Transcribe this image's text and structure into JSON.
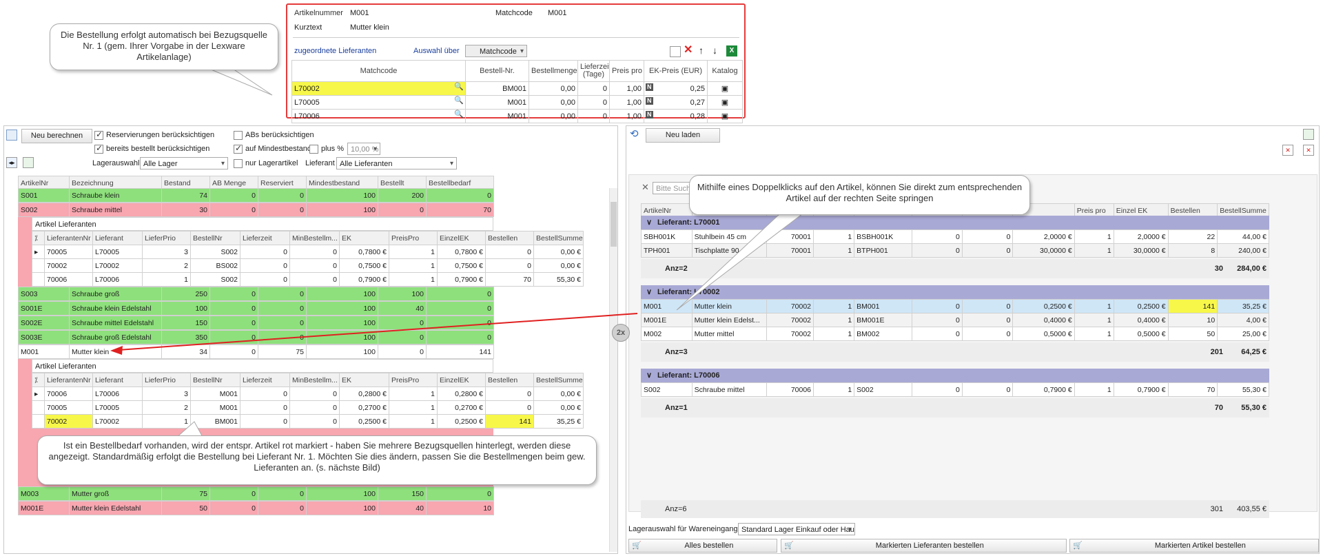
{
  "top": {
    "artikelnummer_label": "Artikelnummer",
    "artikelnummer": "M001",
    "matchcode_label": "Matchcode",
    "matchcode": "M001",
    "kurztext_label": "Kurztext",
    "kurztext": "Mutter klein",
    "tab_label": "zugeordnete Lieferanten",
    "auswahl_label": "Auswahl über",
    "auswahl_value": "Matchcode",
    "columns": [
      "Matchcode",
      "Bestell-Nr.",
      "Bestellmenge",
      "Lieferzeit (Tage)",
      "Preis pro",
      "EK-Preis (EUR)",
      "Katalog"
    ],
    "rows": [
      {
        "matchcode": "L70002",
        "bestellnr": "BM001",
        "menge": "0,00",
        "lieferzeit": "0",
        "preis_pro": "1,00",
        "n": "N",
        "ek": "0,25"
      },
      {
        "matchcode": "L70005",
        "bestellnr": "M001",
        "menge": "0,00",
        "lieferzeit": "0",
        "preis_pro": "1,00",
        "n": "N",
        "ek": "0,27"
      },
      {
        "matchcode": "L70006",
        "bestellnr": "M001",
        "menge": "0,00",
        "lieferzeit": "0",
        "preis_pro": "1,00",
        "n": "N",
        "ek": "0,28"
      }
    ]
  },
  "callouts": {
    "c1": "Die Bestellung erfolgt automatisch bei Bezugsquelle Nr. 1 (gem. Ihrer Vorgabe in der Lexware Artikelanlage)",
    "c2": "Mithilfe eines Doppelklicks auf den Artikel, können Sie direkt zum entsprechenden Artikel auf der rechten Seite springen",
    "c3": "Ist ein Bestellbedarf vorhanden, wird der entspr. Artikel rot markiert - haben Sie mehrere Bezugsquellen hinterlegt, werden diese angezeigt. Standardmäßig erfolgt die Bestellung bei Lieferant Nr. 1. Möchten Sie dies ändern, passen Sie die Bestellmengen beim gew. Lieferanten an. (s. nächste Bild)",
    "badge": "2x"
  },
  "left": {
    "recalc": "Neu berechnen",
    "res": "Reservierungen berücksichtigen",
    "abs": "ABs berücksichtigen",
    "bestellt": "bereits bestellt berücksichtigen",
    "mindest": "auf Mindestbestand",
    "plus": "plus %",
    "plus_val": "10,00 %",
    "lager_label": "Lagerauswahl",
    "lager_val": "Alle Lager",
    "nur": "nur Lagerartikel",
    "lief_label": "Lieferant",
    "lief_val": "Alle Lieferanten",
    "columns": [
      "ArtikelNr",
      "Bezeichnung",
      "Bestand",
      "AB Menge",
      "Reserviert",
      "Mindestbestand",
      "Bestellt",
      "Bestellbedarf"
    ],
    "sub_title": "Artikel Lieferanten",
    "sub_columns": [
      "LieferantenNr",
      "Lieferant",
      "LieferPrio",
      "BestellNr",
      "Lieferzeit",
      "MinBestellm...",
      "EK",
      "PreisPro",
      "EinzelEK",
      "Bestellen",
      "BestellSumme"
    ],
    "r1": [
      "S001",
      "Schraube klein",
      "74",
      "0",
      "0",
      "100",
      "200",
      "0"
    ],
    "r2": [
      "S002",
      "Schraube mittel",
      "30",
      "0",
      "0",
      "100",
      "0",
      "70"
    ],
    "s2": [
      [
        "70005",
        "L70005",
        "3",
        "S002",
        "0",
        "0",
        "0,7800 €",
        "1",
        "0,7800 €",
        "0",
        "0,00 €"
      ],
      [
        "70002",
        "L70002",
        "2",
        "BS002",
        "0",
        "0",
        "0,7500 €",
        "1",
        "0,7500 €",
        "0",
        "0,00 €"
      ],
      [
        "70006",
        "L70006",
        "1",
        "S002",
        "0",
        "0",
        "0,7900 €",
        "1",
        "0,7900 €",
        "70",
        "55,30 €"
      ]
    ],
    "r3": [
      "S003",
      "Schraube groß",
      "250",
      "0",
      "0",
      "100",
      "100",
      "0"
    ],
    "r4": [
      "S001E",
      "Schraube klein Edelstahl",
      "100",
      "0",
      "0",
      "100",
      "40",
      "0"
    ],
    "r5": [
      "S002E",
      "Schraube mittel Edelstahl",
      "150",
      "0",
      "0",
      "100",
      "0",
      "0"
    ],
    "r6": [
      "S003E",
      "Schraube groß Edelstahl",
      "350",
      "0",
      "0",
      "100",
      "0",
      "0"
    ],
    "r7": [
      "M001",
      "Mutter klein",
      "34",
      "0",
      "75",
      "100",
      "0",
      "141"
    ],
    "s7": [
      [
        "70006",
        "L70006",
        "3",
        "M001",
        "0",
        "0",
        "0,2800 €",
        "1",
        "0,2800 €",
        "0",
        "0,00 €"
      ],
      [
        "70005",
        "L70005",
        "2",
        "M001",
        "0",
        "0",
        "0,2700 €",
        "1",
        "0,2700 €",
        "0",
        "0,00 €"
      ],
      [
        "70002",
        "L70002",
        "1",
        "BM001",
        "0",
        "0",
        "0,2500 €",
        "1",
        "0,2500 €",
        "141",
        "35,25 €"
      ]
    ],
    "r8": [
      "M003",
      "Mutter groß",
      "75",
      "0",
      "0",
      "100",
      "150",
      "0"
    ],
    "r9": [
      "M001E",
      "Mutter klein Edelstahl",
      "50",
      "0",
      "0",
      "100",
      "40",
      "10"
    ]
  },
  "right": {
    "reload": "Neu laden",
    "search": "Bitte Suchte",
    "columns": [
      "ArtikelNr",
      "Preis pro",
      "Einzel EK",
      "Bestellen",
      "BestellSumme"
    ],
    "g1": "Lieferant: L70001",
    "g2": "Lieferant: L70002",
    "g3": "Lieferant: L70006",
    "a1": [
      [
        "SBH001K",
        "Stuhlbein 45 cm",
        "70001",
        "1",
        "BSBH001K",
        "0",
        "0",
        "2,0000 €",
        "1",
        "2,0000 €",
        "22",
        "44,00 €"
      ],
      [
        "TPH001",
        "Tischplatte 90",
        "70001",
        "1",
        "BTPH001",
        "0",
        "0",
        "30,0000 €",
        "1",
        "30,0000 €",
        "8",
        "240,00 €"
      ]
    ],
    "t1": [
      "Anz=2",
      "30",
      "284,00 €"
    ],
    "a2": [
      [
        "M001",
        "Mutter klein",
        "70002",
        "1",
        "BM001",
        "0",
        "0",
        "0,2500 €",
        "1",
        "0,2500 €",
        "141",
        "35,25 €"
      ],
      [
        "M001E",
        "Mutter klein Edelst...",
        "70002",
        "1",
        "BM001E",
        "0",
        "0",
        "0,4000 €",
        "1",
        "0,4000 €",
        "10",
        "4,00 €"
      ],
      [
        "M002",
        "Mutter mittel",
        "70002",
        "1",
        "BM002",
        "0",
        "0",
        "0,5000 €",
        "1",
        "0,5000 €",
        "50",
        "25,00 €"
      ]
    ],
    "t2": [
      "Anz=3",
      "201",
      "64,25 €"
    ],
    "a3": [
      [
        "S002",
        "Schraube mittel",
        "70006",
        "1",
        "S002",
        "0",
        "0",
        "0,7900 €",
        "1",
        "0,7900 €",
        "70",
        "55,30 €"
      ]
    ],
    "t3": [
      "Anz=1",
      "70",
      "55,30 €"
    ],
    "total": [
      "Anz=6",
      "301",
      "403,55 €"
    ],
    "lager_label": "Lagerauswahl für Wareneingang",
    "lager_val": "Standard Lager Einkauf oder Hauptlager",
    "b1": "Alles bestellen",
    "b2": "Markierten Lieferanten bestellen",
    "b3": "Markierten Artikel bestellen"
  },
  "colors": {
    "green": "#8ee07c",
    "red": "#f8a6b0",
    "group": "#a9a9d6",
    "highlight": "#f7f74a",
    "arrow": "#e02020"
  }
}
